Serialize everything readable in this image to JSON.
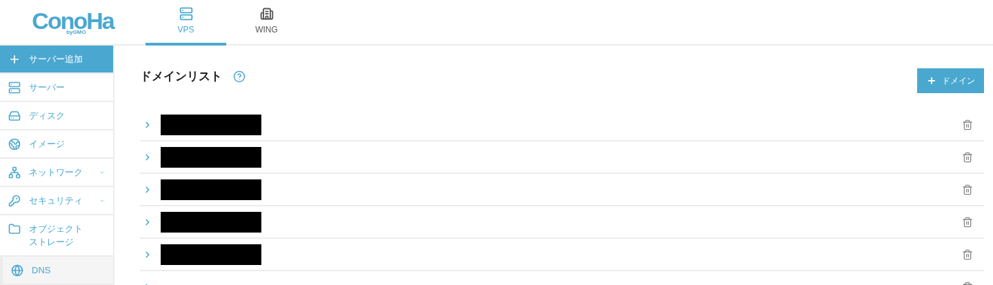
{
  "logo": {
    "text": "ConoHa",
    "sub": "byGMO"
  },
  "tabs": [
    {
      "label": "VPS",
      "selected": true
    },
    {
      "label": "WING",
      "selected": false
    }
  ],
  "sidebar": {
    "items": [
      {
        "label": "サーバー追加",
        "kind": "action"
      },
      {
        "label": "サーバー",
        "kind": "link",
        "selected": false
      },
      {
        "label": "ディスク",
        "kind": "link",
        "selected": false
      },
      {
        "label": "イメージ",
        "kind": "link",
        "selected": false
      },
      {
        "label": "ネットワーク",
        "kind": "group",
        "expanded": false,
        "selected": false
      },
      {
        "label": "セキュリティ",
        "kind": "group",
        "expanded": false,
        "selected": false
      },
      {
        "label": "オブジェクトストレージ",
        "kind": "link",
        "selected": false
      },
      {
        "label": "DNS",
        "kind": "link",
        "selected": true
      }
    ]
  },
  "main": {
    "title": "ドメインリスト",
    "add_button": "ドメイン",
    "rows": [
      {
        "redacted": true
      },
      {
        "redacted": true
      },
      {
        "redacted": true
      },
      {
        "redacted": true
      },
      {
        "redacted": true
      },
      {
        "redacted": false
      }
    ]
  }
}
